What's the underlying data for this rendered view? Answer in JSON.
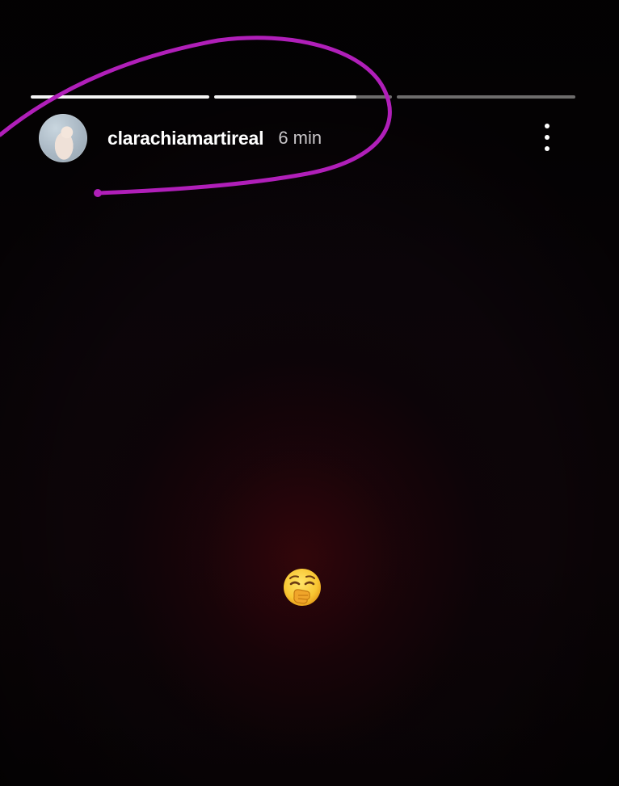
{
  "story": {
    "progress_segments": [
      {
        "state": "viewed",
        "fill": 1.0
      },
      {
        "state": "current",
        "fill": 0.8
      },
      {
        "state": "upcoming",
        "fill": 0.0
      }
    ],
    "username": "clarachiamartireal",
    "time_ago": "6 min",
    "menu_icon": "more-vertical-icon",
    "sticker": "yawning-face-emoji"
  },
  "annotation": {
    "color": "#b01fb9",
    "shape": "hand-drawn loop around username"
  },
  "colors": {
    "background": "#0a0407",
    "glow": "#48060c",
    "text": "#ffffff",
    "muted_text": "#c9c6c9"
  }
}
